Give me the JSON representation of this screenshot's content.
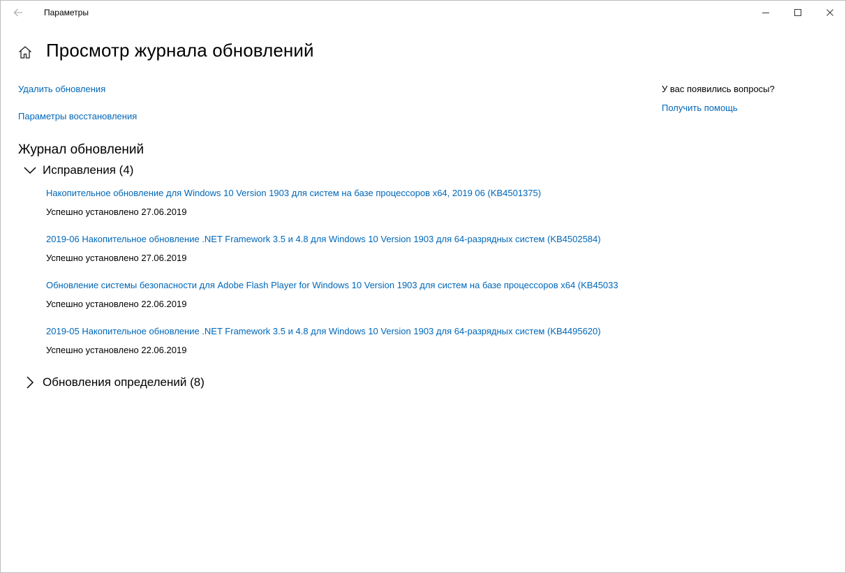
{
  "window": {
    "app_title": "Параметры"
  },
  "header": {
    "page_title": "Просмотр журнала обновлений"
  },
  "links": {
    "uninstall": "Удалить обновления",
    "recovery": "Параметры восстановления"
  },
  "history": {
    "section_title": "Журнал обновлений",
    "fixes": {
      "label": "Исправления (4)",
      "expanded": true,
      "items": [
        {
          "title": "Накопительное обновление для Windows 10 Version 1903 для систем на базе процессоров x64, 2019 06 (KB4501375)",
          "status": "Успешно установлено 27.06.2019"
        },
        {
          "title": "2019-06 Накопительное обновление .NET Framework 3.5 и 4.8 для Windows 10 Version 1903 для 64-разрядных систем (KB4502584)",
          "status": "Успешно установлено 27.06.2019"
        },
        {
          "title": "Обновление системы безопасности для Adobe Flash Player for Windows 10 Version 1903 для систем на базе процессоров x64 (KB45033",
          "status": "Успешно установлено 22.06.2019"
        },
        {
          "title": "2019-05 Накопительное обновление .NET Framework 3.5 и 4.8 для Windows 10 Version 1903 для 64-разрядных систем (KB4495620)",
          "status": "Успешно установлено 22.06.2019"
        }
      ]
    },
    "definitions": {
      "label": "Обновления определений (8)",
      "expanded": false
    }
  },
  "help": {
    "title": "У вас появились вопросы?",
    "link": "Получить помощь"
  },
  "colors": {
    "link": "#0067b8",
    "text": "#000000",
    "background": "#ffffff"
  },
  "icons": {
    "back": "back-arrow-icon",
    "home": "home-icon",
    "minimize": "minimize-icon",
    "maximize": "maximize-icon",
    "close": "close-icon",
    "expanded": "chevron-down-icon",
    "collapsed": "chevron-right-icon"
  }
}
